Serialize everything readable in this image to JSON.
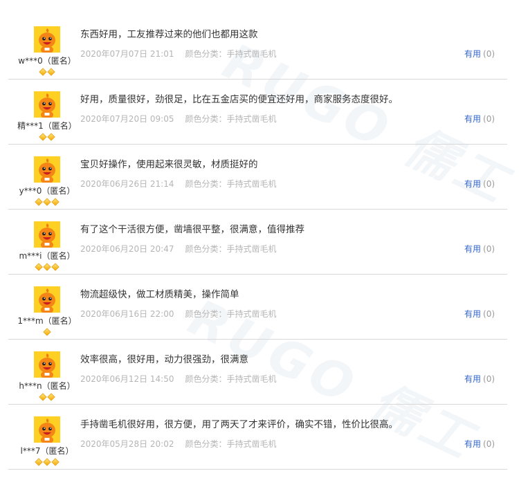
{
  "watermark": "RUGO 儒工",
  "colors": {
    "accent": "#3366cc",
    "avatar_bg": "#fdd023",
    "meta_text": "#b5b5b5",
    "badge": "#f5a800"
  },
  "reviews": [
    {
      "user": "w***0（匿名）",
      "badges": 2,
      "text": "东西好用，工友推荐过来的他们也都用这款",
      "date": "2020年07月07日 21:01",
      "sku": "颜色分类：手持式凿毛机",
      "useful_label": "有用",
      "useful_count": "(0)"
    },
    {
      "user": "精***1（匿名）",
      "badges": 2,
      "text": "好用，质量很好，劲很足，比在五金店买的便宜还好用，商家服务态度很好。",
      "date": "2020年07月20日 09:05",
      "sku": "颜色分类：手持式凿毛机",
      "useful_label": "有用",
      "useful_count": "(0)"
    },
    {
      "user": "y***0（匿名）",
      "badges": 3,
      "text": "宝贝好操作，使用起来很灵敏，材质挺好的",
      "date": "2020年06月26日 21:14",
      "sku": "颜色分类：手持式凿毛机",
      "useful_label": "有用",
      "useful_count": "(0)"
    },
    {
      "user": "m***i（匿名）",
      "badges": 3,
      "text": "有了这个干活很方便，凿墙很平整，很满意，值得推荐",
      "date": "2020年06月20日 20:47",
      "sku": "颜色分类：手持式凿毛机",
      "useful_label": "有用",
      "useful_count": "(0)"
    },
    {
      "user": "1***m（匿名）",
      "badges": 1,
      "text": "物流超级快，做工材质精美，操作简单",
      "date": "2020年06月16日 22:00",
      "sku": "颜色分类：手持式凿毛机",
      "useful_label": "有用",
      "useful_count": "(0)"
    },
    {
      "user": "h***n（匿名）",
      "badges": 2,
      "text": "效率很高，很好用，动力很强劲，很满意",
      "date": "2020年06月12日 14:50",
      "sku": "颜色分类：手持式凿毛机",
      "useful_label": "有用",
      "useful_count": "(0)"
    },
    {
      "user": "l***7（匿名）",
      "badges": 3,
      "text": "手持凿毛机很好用，很方便，用了两天了才来评价，确实不错，性价比很高。",
      "date": "2020年05月28日 20:02",
      "sku": "颜色分类：手持式凿毛机",
      "useful_label": "有用",
      "useful_count": "(0)"
    }
  ]
}
